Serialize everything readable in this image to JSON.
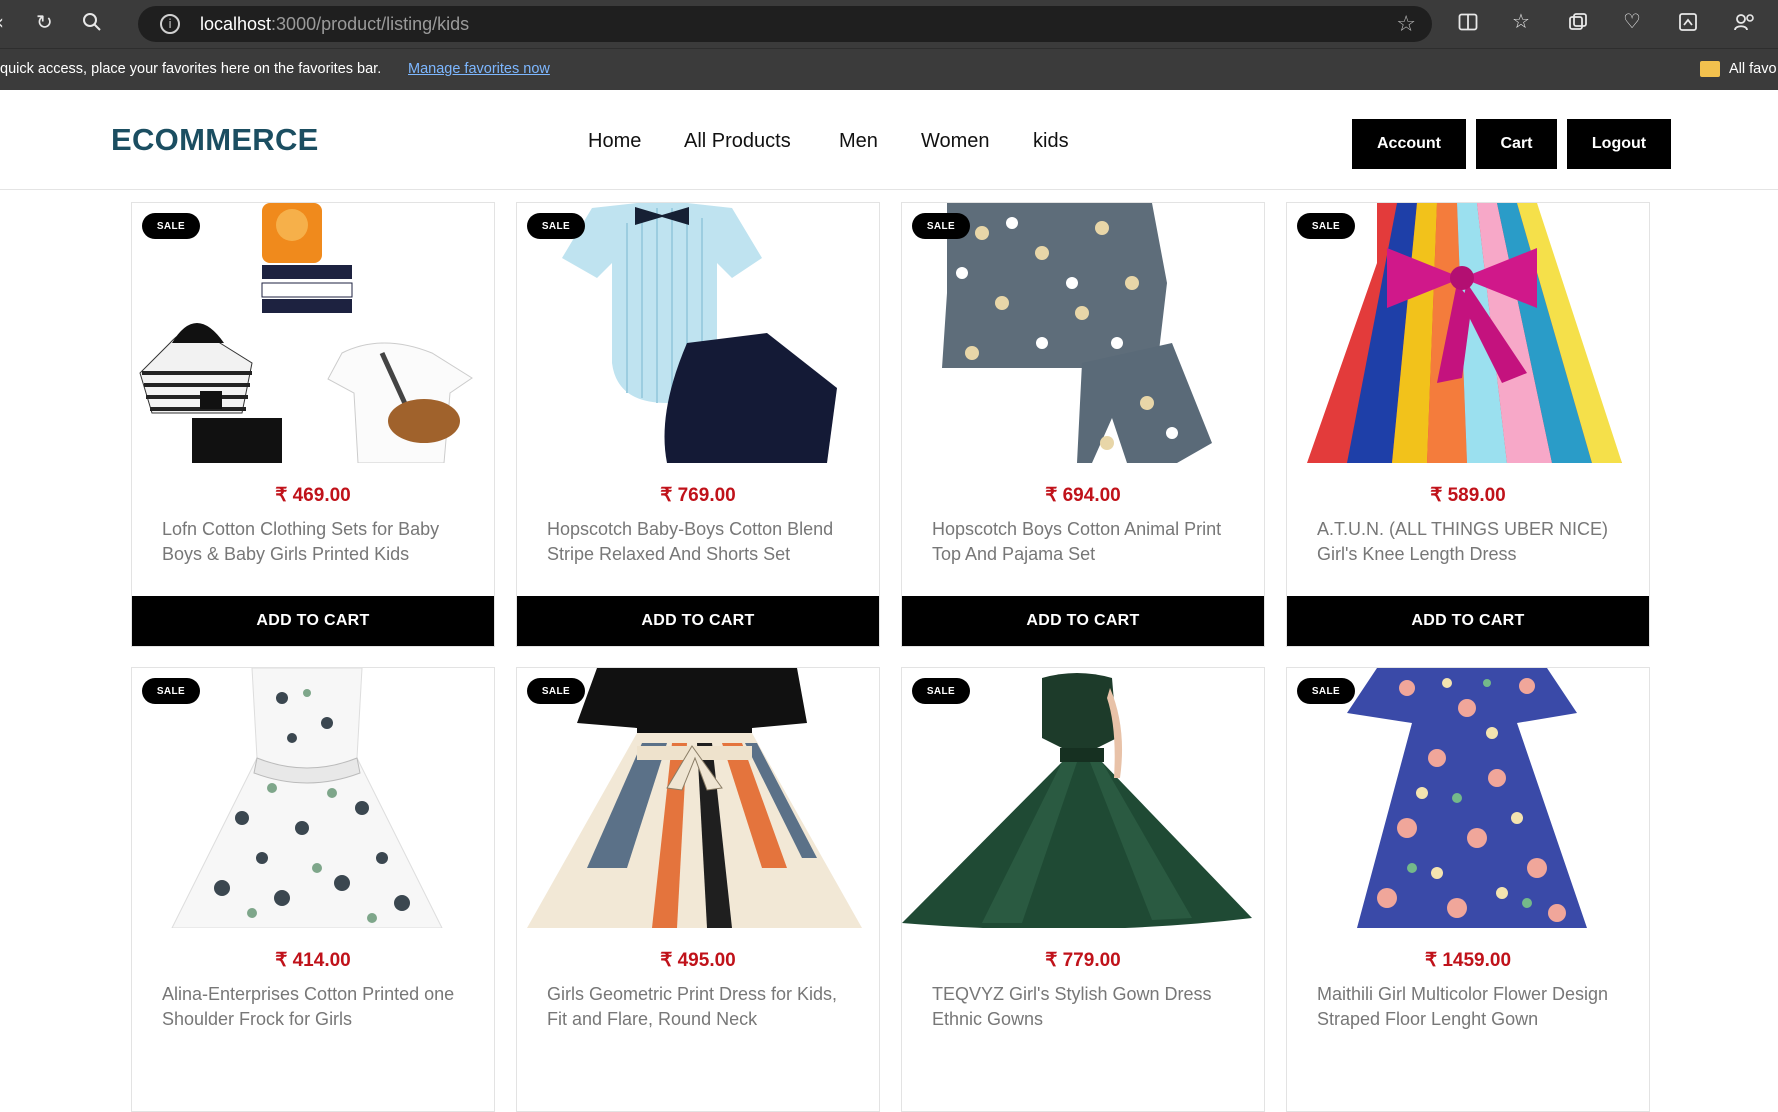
{
  "browser": {
    "url_host": "localhost",
    "url_rest": ":3000/product/listing/kids",
    "favorites_message": "quick access, place your favorites here on the favorites bar.",
    "favorites_link": "Manage favorites now",
    "all_favorites": "All favo"
  },
  "header": {
    "logo": "ECOMMERCE",
    "nav": [
      "Home",
      "All Products",
      "Men",
      "Women",
      "kids"
    ],
    "buttons": [
      "Account",
      "Cart",
      "Logout"
    ]
  },
  "sale_label": "SALE",
  "add_to_cart_label": "ADD TO CART",
  "products": [
    {
      "price": "₹ 469.00",
      "title": "Lofn Cotton Clothing Sets for Baby Boys & Baby Girls Printed Kids",
      "image": "baby-clothing-set-image"
    },
    {
      "price": "₹ 769.00",
      "title": "Hopscotch Baby-Boys Cotton Blend Stripe Relaxed And Shorts Set",
      "image": "romper-shorts-set-image"
    },
    {
      "price": "₹ 694.00",
      "title": "Hopscotch Boys Cotton Animal Print Top And Pajama Set",
      "image": "animal-print-pajama-image"
    },
    {
      "price": "₹ 589.00",
      "title": "A.T.U.N. (ALL THINGS UBER NICE) Girl's Knee Length Dress",
      "image": "striped-bow-dress-image"
    },
    {
      "price": "₹ 414.00",
      "title": "Alina-Enterprises Cotton Printed one Shoulder Frock for Girls",
      "image": "floral-frock-image"
    },
    {
      "price": "₹ 495.00",
      "title": "Girls Geometric Print Dress for Kids, Fit and Flare, Round Neck",
      "image": "geometric-dress-image"
    },
    {
      "price": "₹ 779.00",
      "title": "TEQVYZ Girl's Stylish Gown Dress Ethnic Gowns",
      "image": "green-gown-image"
    },
    {
      "price": "₹ 1459.00",
      "title": "Maithili Girl Multicolor Flower Design Straped Floor Lenght Gown",
      "image": "flower-gown-image"
    }
  ]
}
